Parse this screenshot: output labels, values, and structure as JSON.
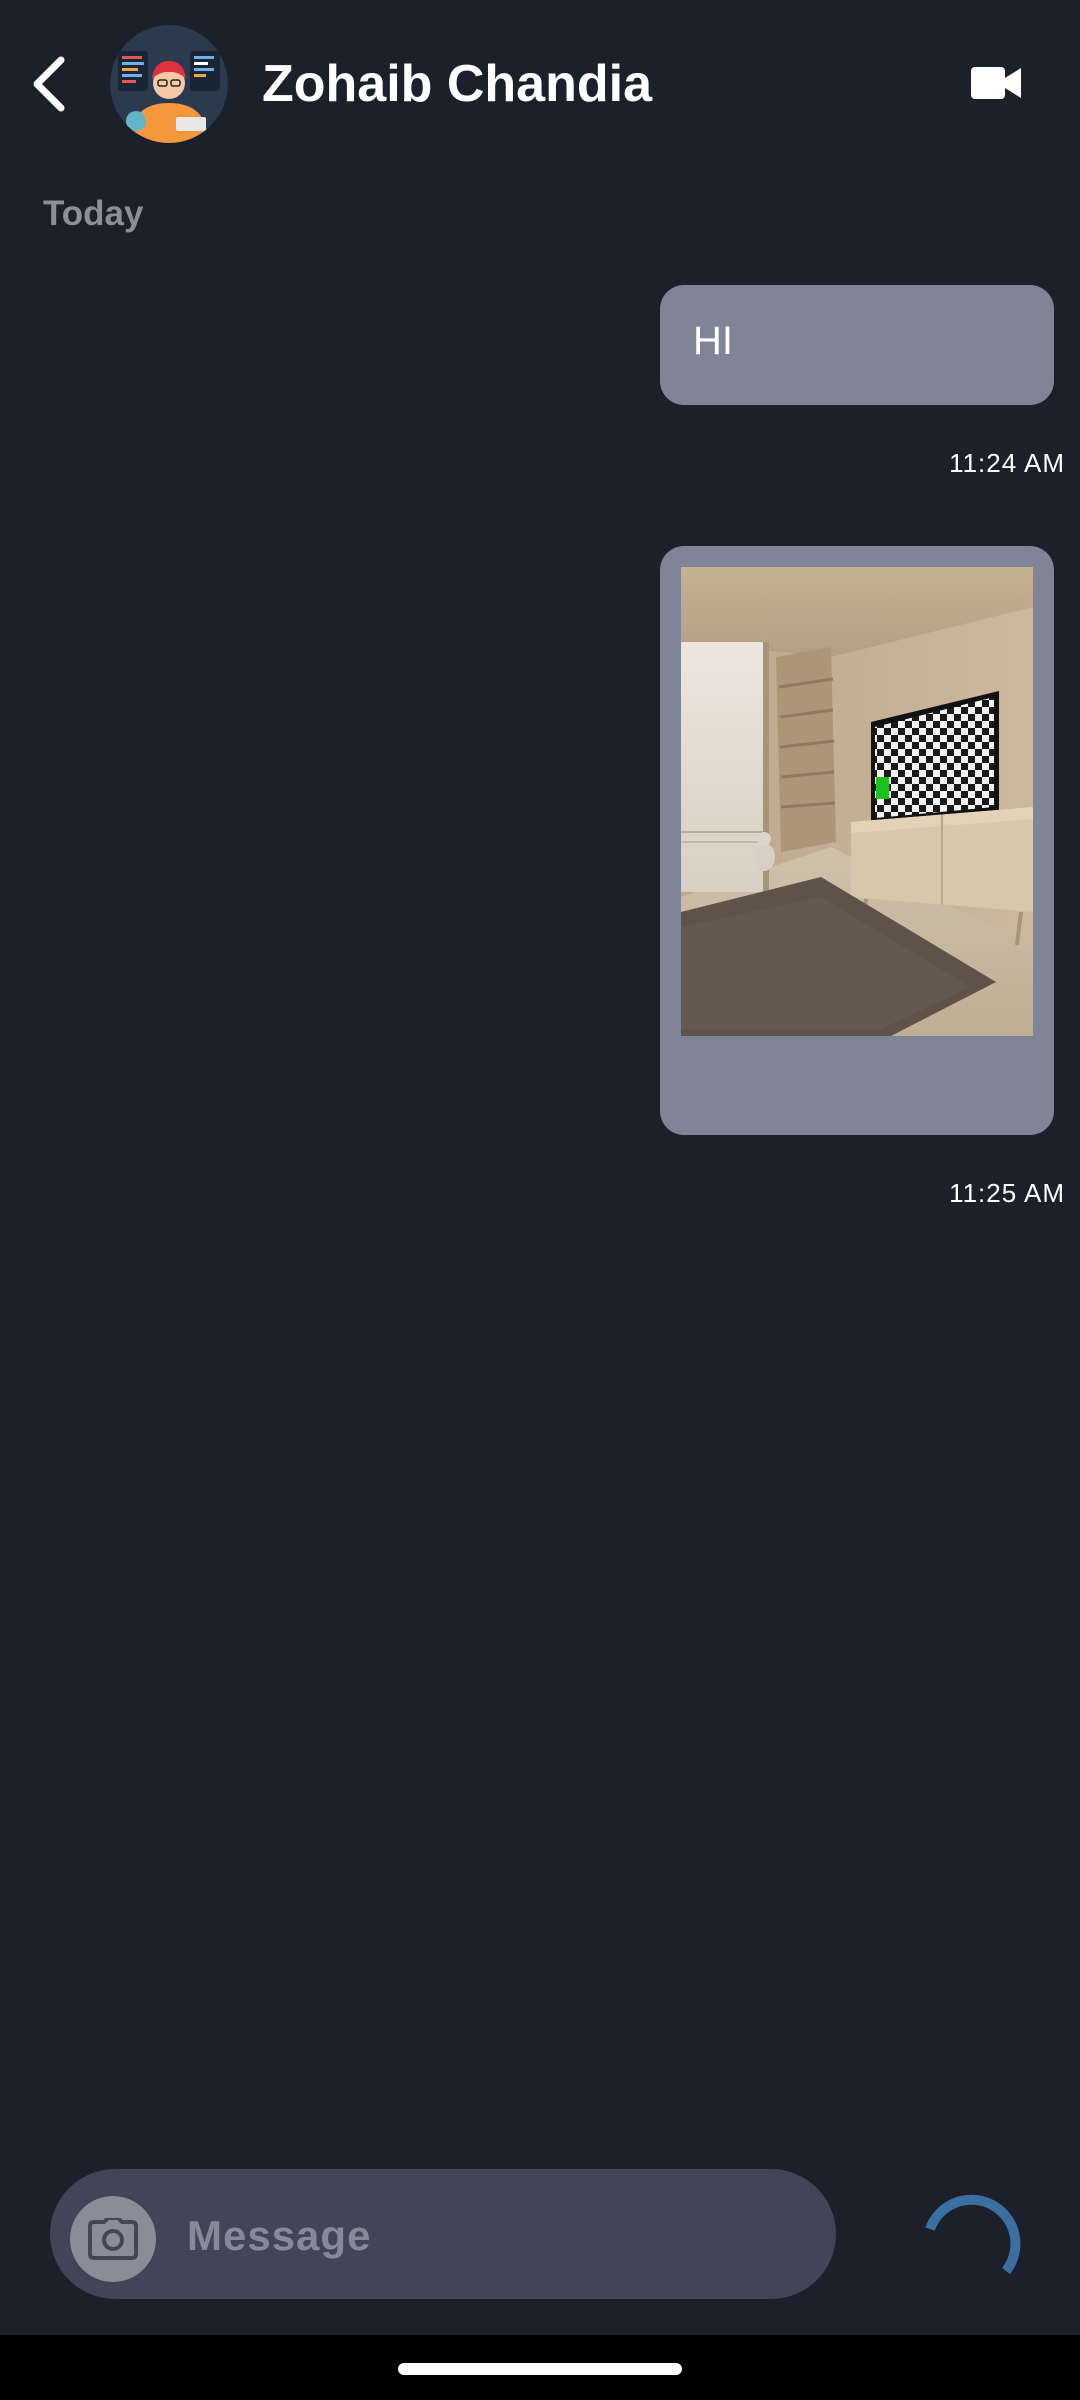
{
  "header": {
    "contact_name": "Zohaib Chandia",
    "back_icon": "chevron-left-icon",
    "video_icon": "video-camera-icon"
  },
  "chat": {
    "date_divider": "Today",
    "messages": [
      {
        "type": "text",
        "text": "HI",
        "time": "11:24 AM"
      },
      {
        "type": "image",
        "time": "11:25 AM"
      }
    ]
  },
  "composer": {
    "placeholder": "Message",
    "value": "",
    "camera_icon": "camera-icon"
  },
  "colors": {
    "background": "#1c202b",
    "bubble": "#7f8597",
    "input_bar": "#404558",
    "spinner": "#3b6fa0"
  }
}
